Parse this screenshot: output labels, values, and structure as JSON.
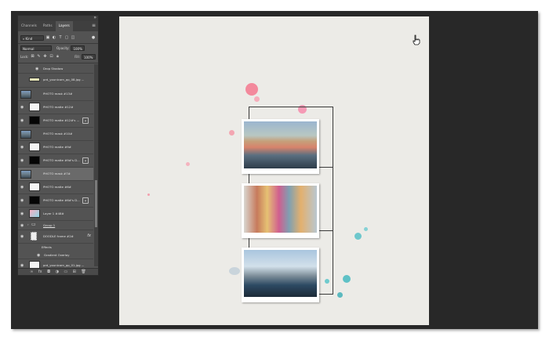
{
  "panel": {
    "tabs": [
      {
        "label": "Channels",
        "active": false
      },
      {
        "label": "Paths",
        "active": false
      },
      {
        "label": "Layers",
        "active": true
      }
    ],
    "filter_kind": "Kind",
    "blend_mode": "Normal",
    "opacity_label": "Opacity:",
    "opacity_value": "100%",
    "lock_label": "Lock:",
    "fill_label": "Fill:",
    "fill_value": "100%",
    "layers": [
      {
        "name": "Drop Shadow",
        "type": "effect"
      },
      {
        "name": "prd_younicorn_pp_08.jpg ...",
        "type": "image"
      },
      {
        "name": "PHOTO mask #13#",
        "type": "photo"
      },
      {
        "name": "PHOTO matte #12#",
        "type": "white"
      },
      {
        "name": "PHOTO matte #12#'s ...",
        "type": "black"
      },
      {
        "name": "PHOTO mask #10#",
        "type": "photo"
      },
      {
        "name": "PHOTO matte #9#",
        "type": "white"
      },
      {
        "name": "PHOTO matte #9#'s D...",
        "type": "black"
      },
      {
        "name": "PHOTO mask #7#",
        "type": "photo",
        "selected": true
      },
      {
        "name": "PHOTO matte #6#",
        "type": "white"
      },
      {
        "name": "PHOTO matte #6#'s D...",
        "type": "black"
      },
      {
        "name": "Layer 1 #48#",
        "type": "gradient"
      },
      {
        "name": "Group 1",
        "type": "group"
      },
      {
        "name": "DOODLE frame #2#",
        "type": "doodle"
      },
      {
        "name": "Effects",
        "type": "effects-header"
      },
      {
        "name": "Gradient Overlay",
        "type": "effect"
      },
      {
        "name": "prd_younicorn_pp_01.jpg ...",
        "type": "white"
      }
    ],
    "fx_label": "fx"
  },
  "icons": {
    "eye": "eye-icon",
    "cursor": "hand-cursor-icon"
  },
  "colors": {
    "canvas": "#ecebe7",
    "workspace": "#282828",
    "panel": "#535353",
    "splat_pink": "#f28aa0",
    "splat_teal": "#5fc4c9"
  }
}
